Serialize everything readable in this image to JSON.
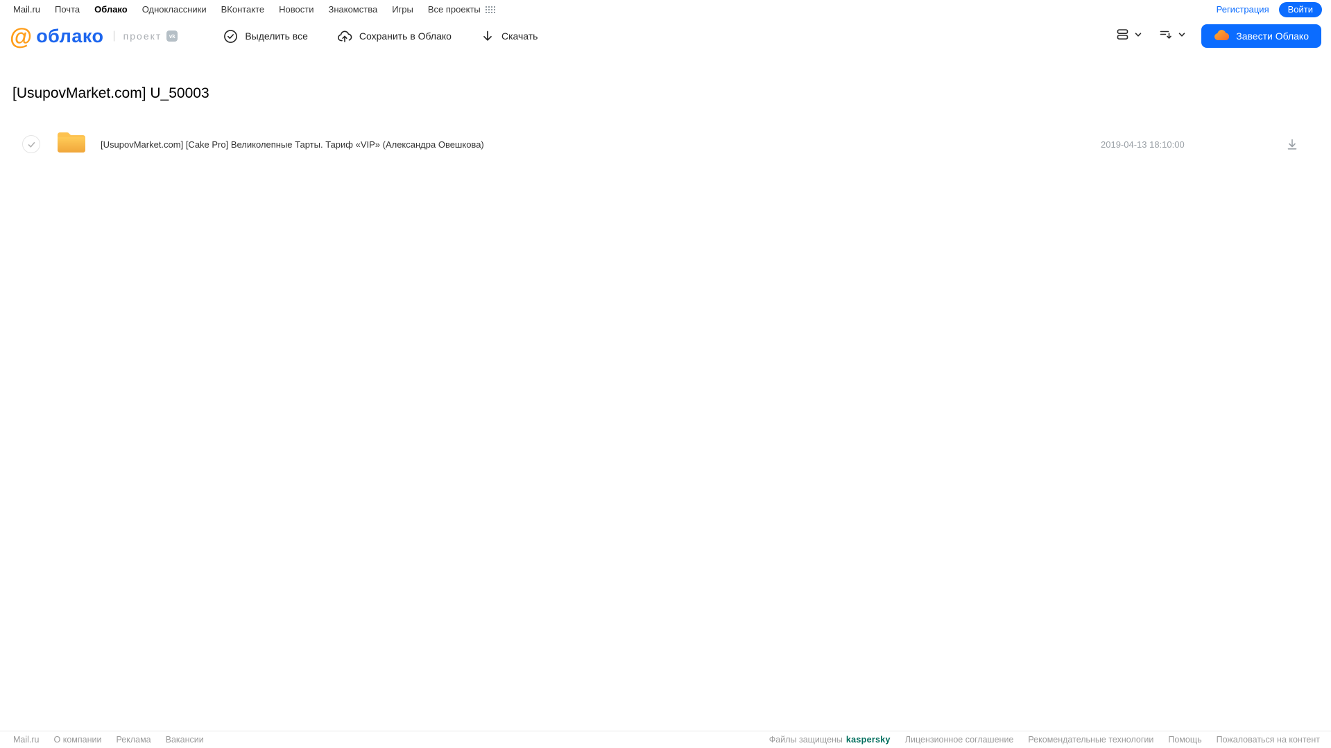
{
  "topnav": {
    "items": [
      {
        "label": "Mail.ru"
      },
      {
        "label": "Почта"
      },
      {
        "label": "Облако"
      },
      {
        "label": "Одноклассники"
      },
      {
        "label": "ВКонтакте"
      },
      {
        "label": "Новости"
      },
      {
        "label": "Знакомства"
      },
      {
        "label": "Игры"
      },
      {
        "label": "Все проекты"
      }
    ],
    "registration_label": "Регистрация",
    "login_label": "Войти"
  },
  "header": {
    "logo_at": "@",
    "logo_word": "облако",
    "project_label": "проект",
    "vk_badge": "vk",
    "toolbar": {
      "select_all": "Выделить все",
      "save_to_cloud": "Сохранить в Облако",
      "download": "Скачать"
    },
    "create_cloud_label": "Завести Облако"
  },
  "main": {
    "title": "[UsupovMarket.com] U_50003",
    "files": [
      {
        "type": "folder",
        "name": "[UsupovMarket.com] [Cake Pro] Великолепные Тарты. Тариф «VIP» (Александра Овешкова)",
        "date": "2019-04-13 18:10:00"
      }
    ]
  },
  "footer": {
    "left_links": [
      {
        "label": "Mail.ru"
      },
      {
        "label": "О компании"
      },
      {
        "label": "Реклама"
      },
      {
        "label": "Вакансии"
      }
    ],
    "protected_label": "Файлы защищены",
    "kaspersky_label": "kaspersky",
    "right_links": [
      {
        "label": "Лицензионное соглашение"
      },
      {
        "label": "Рекомендательные технологии"
      },
      {
        "label": "Помощь"
      },
      {
        "label": "Пожаловаться на контент"
      }
    ]
  },
  "colors": {
    "accent_blue": "#0b6cff",
    "logo_blue": "#1d66ee",
    "logo_orange": "#ff9e1b",
    "folder_top": "#ffcb58",
    "folder_bottom": "#f0a63a",
    "kaspersky_green": "#006d5c",
    "muted_gray": "#9a9a9a"
  }
}
